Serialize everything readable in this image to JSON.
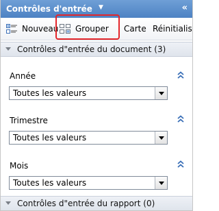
{
  "panel": {
    "title": "Contrôles d'entrée",
    "title_caret": "▼",
    "collapse_glyph": "«"
  },
  "toolbar": {
    "new_label": "Nouveau",
    "group_label": "Grouper",
    "map_label": "Carte",
    "reset_label": "Réinitialise"
  },
  "sections": {
    "document": {
      "label": "Contrôles d\"entrée du document (3)"
    },
    "report": {
      "label": "Contrôles d\"entrée du rapport (0)"
    }
  },
  "filters": [
    {
      "label": "Année",
      "value": "Toutes les valeurs"
    },
    {
      "label": "Trimestre",
      "value": "Toutes les valeurs"
    },
    {
      "label": "Mois",
      "value": "Toutes les valeurs"
    }
  ],
  "colors": {
    "titlebar": "#5a8ccb",
    "highlight": "#e4252a",
    "chevron": "#3a6fb7"
  }
}
